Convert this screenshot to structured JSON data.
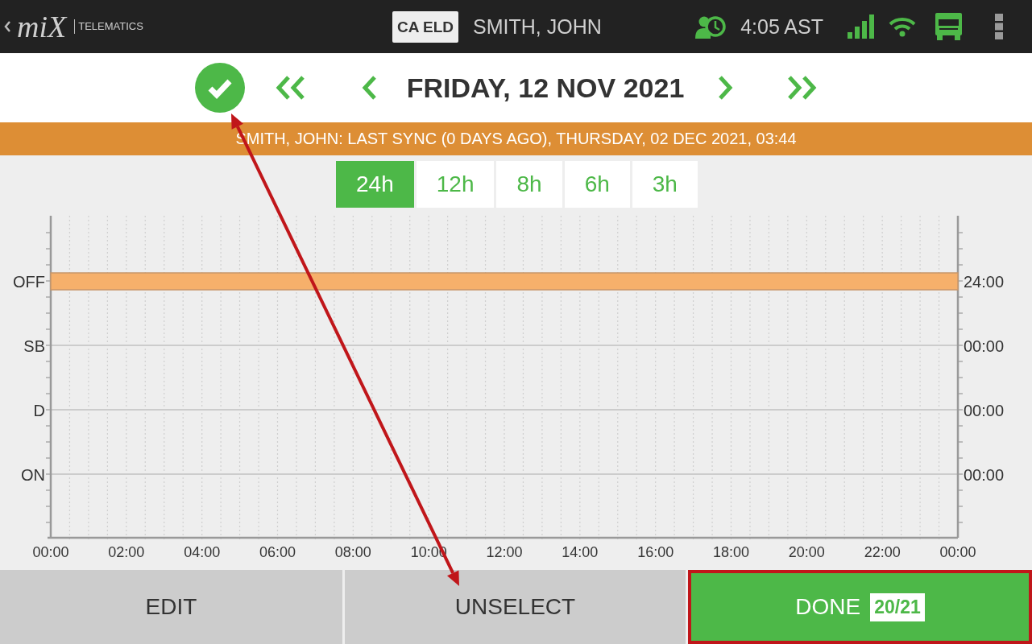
{
  "header": {
    "logo": "miX",
    "logo_subtitle": "TELEMATICS",
    "badge": "CA ELD",
    "driver": "SMITH, JOHN",
    "time": "4:05 AST"
  },
  "date_nav": {
    "date": "FRIDAY, 12 NOV 2021"
  },
  "sync_banner": "SMITH, JOHN: LAST SYNC (0 DAYS AGO), THURSDAY, 02 DEC 2021, 03:44",
  "zoom_tabs": [
    {
      "label": "24h",
      "selected": true
    },
    {
      "label": "12h",
      "selected": false
    },
    {
      "label": "8h",
      "selected": false
    },
    {
      "label": "6h",
      "selected": false
    },
    {
      "label": "3h",
      "selected": false
    }
  ],
  "log_graph": {
    "totals": [
      "24:00",
      "00:00",
      "00:00",
      "00:00"
    ],
    "chart_data": {
      "type": "bar",
      "orientation": "horizontal",
      "grid": true,
      "categories": [
        "OFF",
        "SB",
        "D",
        "ON"
      ],
      "values": [
        24,
        0,
        0,
        0
      ],
      "xlim": [
        0,
        24
      ],
      "xticks": [
        {
          "value": 0,
          "label": "00:00"
        },
        {
          "value": 2,
          "label": "02:00"
        },
        {
          "value": 4,
          "label": "04:00"
        },
        {
          "value": 6,
          "label": "06:00"
        },
        {
          "value": 8,
          "label": "08:00"
        },
        {
          "value": 10,
          "label": "10:00"
        },
        {
          "value": 12,
          "label": "12:00"
        },
        {
          "value": 14,
          "label": "14:00"
        },
        {
          "value": 16,
          "label": "16:00"
        },
        {
          "value": 18,
          "label": "18:00"
        },
        {
          "value": 20,
          "label": "20:00"
        },
        {
          "value": 22,
          "label": "22:00"
        },
        {
          "value": 24,
          "label": "00:00"
        }
      ]
    }
  },
  "actions": [
    {
      "label": "EDIT",
      "kind": "plain",
      "highlighted": false
    },
    {
      "label": "UNSELECT",
      "kind": "plain",
      "highlighted": false
    },
    {
      "label": "DONE",
      "kind": "primary",
      "count": "20/21",
      "highlighted": true
    }
  ],
  "annotation": {
    "kind": "double-arrow"
  }
}
